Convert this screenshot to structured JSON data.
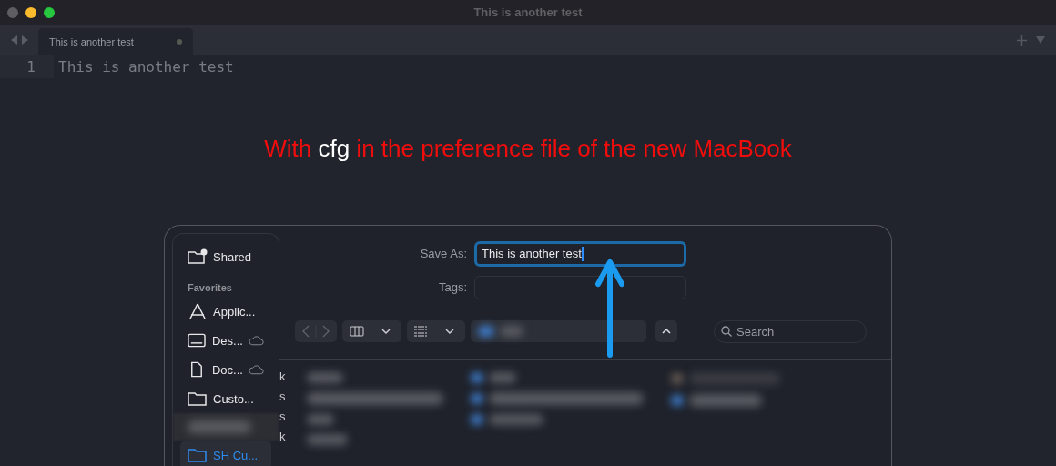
{
  "window": {
    "title": "This is another test"
  },
  "tabs": [
    {
      "label": "This is another test",
      "selected": true,
      "modified": true
    }
  ],
  "editor": {
    "lines": [
      {
        "number": "1",
        "text": "This is another test"
      }
    ]
  },
  "annotation": {
    "parts": [
      {
        "text": "With ",
        "highlight": false
      },
      {
        "text": "cfg",
        "highlight": true
      },
      {
        "text": " in the preference file of the new MacBook",
        "highlight": false
      }
    ]
  },
  "save_dialog": {
    "sidebar": [
      {
        "kind": "shared",
        "label": "Shared",
        "cloud": false,
        "selected": false
      },
      {
        "kind": "heading",
        "label": "Favorites"
      },
      {
        "kind": "applications",
        "label": "Applic...",
        "cloud": false,
        "selected": false
      },
      {
        "kind": "desktop",
        "label": "Des...",
        "cloud": true,
        "selected": false
      },
      {
        "kind": "document",
        "label": "Doc...",
        "cloud": true,
        "selected": false
      },
      {
        "kind": "folder",
        "label": "Custo...",
        "cloud": false,
        "selected": false
      },
      {
        "kind": "blurred"
      },
      {
        "kind": "folder",
        "label": "SH Cu...",
        "cloud": false,
        "selected": true
      }
    ],
    "save_as": {
      "label": "Save As:",
      "value": "This is another test"
    },
    "tags": {
      "label": "Tags:"
    },
    "search": {
      "placeholder": "Search"
    },
    "file_fragments": [
      "k",
      "s",
      "s",
      "k"
    ]
  }
}
